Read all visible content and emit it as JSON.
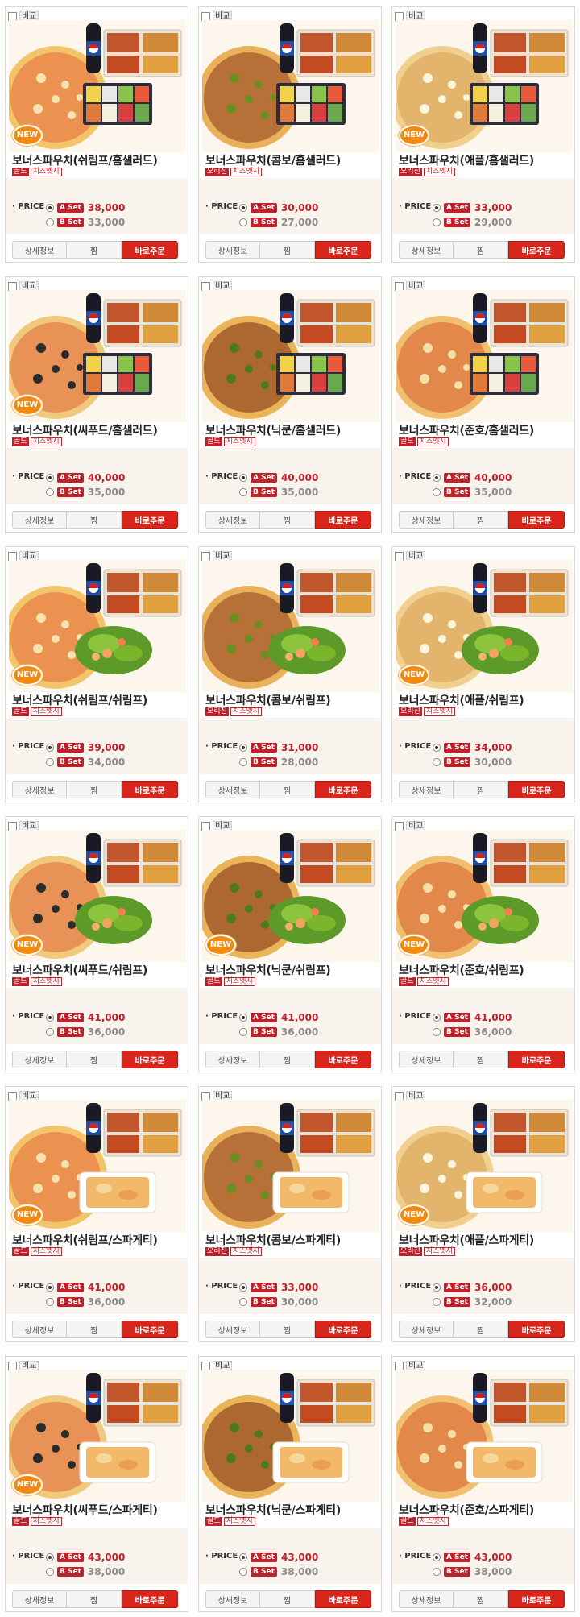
{
  "labels": {
    "compare": "비교",
    "price": "· PRICE",
    "a_set": "A Set",
    "b_set": "B Set",
    "detail": "상세정보",
    "wish": "찜",
    "order": "바로주문",
    "new": "NEW"
  },
  "products": [
    {
      "name": "보너스파우치(쉬림프/홈샐러드)",
      "tags": [
        "골드",
        "치즈엣지"
      ],
      "a_price": "38,000",
      "b_price": "33,000",
      "new": true,
      "pizza": "shrimp",
      "side": "salad"
    },
    {
      "name": "보너스파우치(콤보/홈샐러드)",
      "tags": [
        "오리진",
        "치즈엣지"
      ],
      "a_price": "30,000",
      "b_price": "27,000",
      "new": false,
      "pizza": "combo",
      "side": "salad"
    },
    {
      "name": "보너스파우치(애플/홈샐러드)",
      "tags": [
        "오리진",
        "치즈엣지"
      ],
      "a_price": "33,000",
      "b_price": "29,000",
      "new": true,
      "pizza": "apple",
      "side": "salad"
    },
    {
      "name": "보너스파우치(씨푸드/홈샐러드)",
      "tags": [
        "골드",
        "치즈엣지"
      ],
      "a_price": "40,000",
      "b_price": "35,000",
      "new": true,
      "pizza": "seafood",
      "side": "salad"
    },
    {
      "name": "보너스파우치(닉쿤/홈샐러드)",
      "tags": [
        "골드",
        "치즈엣지"
      ],
      "a_price": "40,000",
      "b_price": "35,000",
      "new": false,
      "pizza": "nickhun",
      "side": "salad"
    },
    {
      "name": "보너스파우치(준호/홈샐러드)",
      "tags": [
        "골드",
        "치즈엣지"
      ],
      "a_price": "40,000",
      "b_price": "35,000",
      "new": false,
      "pizza": "junho",
      "side": "salad"
    },
    {
      "name": "보너스파우치(쉬림프/쉬림프)",
      "tags": [
        "골드",
        "치즈엣지"
      ],
      "a_price": "39,000",
      "b_price": "34,000",
      "new": true,
      "pizza": "shrimp",
      "side": "green"
    },
    {
      "name": "보너스파우치(콤보/쉬림프)",
      "tags": [
        "오리진",
        "치즈엣지"
      ],
      "a_price": "31,000",
      "b_price": "28,000",
      "new": false,
      "pizza": "combo",
      "side": "green"
    },
    {
      "name": "보너스파우치(애플/쉬림프)",
      "tags": [
        "오리진",
        "치즈엣지"
      ],
      "a_price": "34,000",
      "b_price": "30,000",
      "new": true,
      "pizza": "apple",
      "side": "green"
    },
    {
      "name": "보너스파우치(씨푸드/쉬림프)",
      "tags": [
        "골드",
        "치즈엣지"
      ],
      "a_price": "41,000",
      "b_price": "36,000",
      "new": true,
      "pizza": "seafood",
      "side": "green"
    },
    {
      "name": "보너스파우치(닉쿤/쉬림프)",
      "tags": [
        "골드",
        "치즈엣지"
      ],
      "a_price": "41,000",
      "b_price": "36,000",
      "new": true,
      "pizza": "nickhun",
      "side": "green"
    },
    {
      "name": "보너스파우치(준호/쉬림프)",
      "tags": [
        "골드",
        "치즈엣지"
      ],
      "a_price": "41,000",
      "b_price": "36,000",
      "new": true,
      "pizza": "junho",
      "side": "green"
    },
    {
      "name": "보너스파우치(쉬림프/스파게티)",
      "tags": [
        "골드",
        "치즈엣지"
      ],
      "a_price": "41,000",
      "b_price": "36,000",
      "new": true,
      "pizza": "shrimp",
      "side": "pasta"
    },
    {
      "name": "보너스파우치(콤보/스파게티)",
      "tags": [
        "오리진",
        "치즈엣지"
      ],
      "a_price": "33,000",
      "b_price": "30,000",
      "new": false,
      "pizza": "combo",
      "side": "pasta"
    },
    {
      "name": "보너스파우치(애플/스파게티)",
      "tags": [
        "오리진",
        "치즈엣지"
      ],
      "a_price": "36,000",
      "b_price": "32,000",
      "new": true,
      "pizza": "apple",
      "side": "pasta"
    },
    {
      "name": "보너스파우치(씨푸드/스파게티)",
      "tags": [
        "골드",
        "치즈엣지"
      ],
      "a_price": "43,000",
      "b_price": "38,000",
      "new": true,
      "pizza": "seafood",
      "side": "pasta"
    },
    {
      "name": "보너스파우치(닉쿤/스파게티)",
      "tags": [
        "골드",
        "치즈엣지"
      ],
      "a_price": "43,000",
      "b_price": "38,000",
      "new": false,
      "pizza": "nickhun",
      "side": "pasta"
    },
    {
      "name": "보너스파우치(준호/스파게티)",
      "tags": [
        "골드",
        "치즈엣지"
      ],
      "a_price": "43,000",
      "b_price": "38,000",
      "new": false,
      "pizza": "junho",
      "side": "pasta"
    }
  ]
}
